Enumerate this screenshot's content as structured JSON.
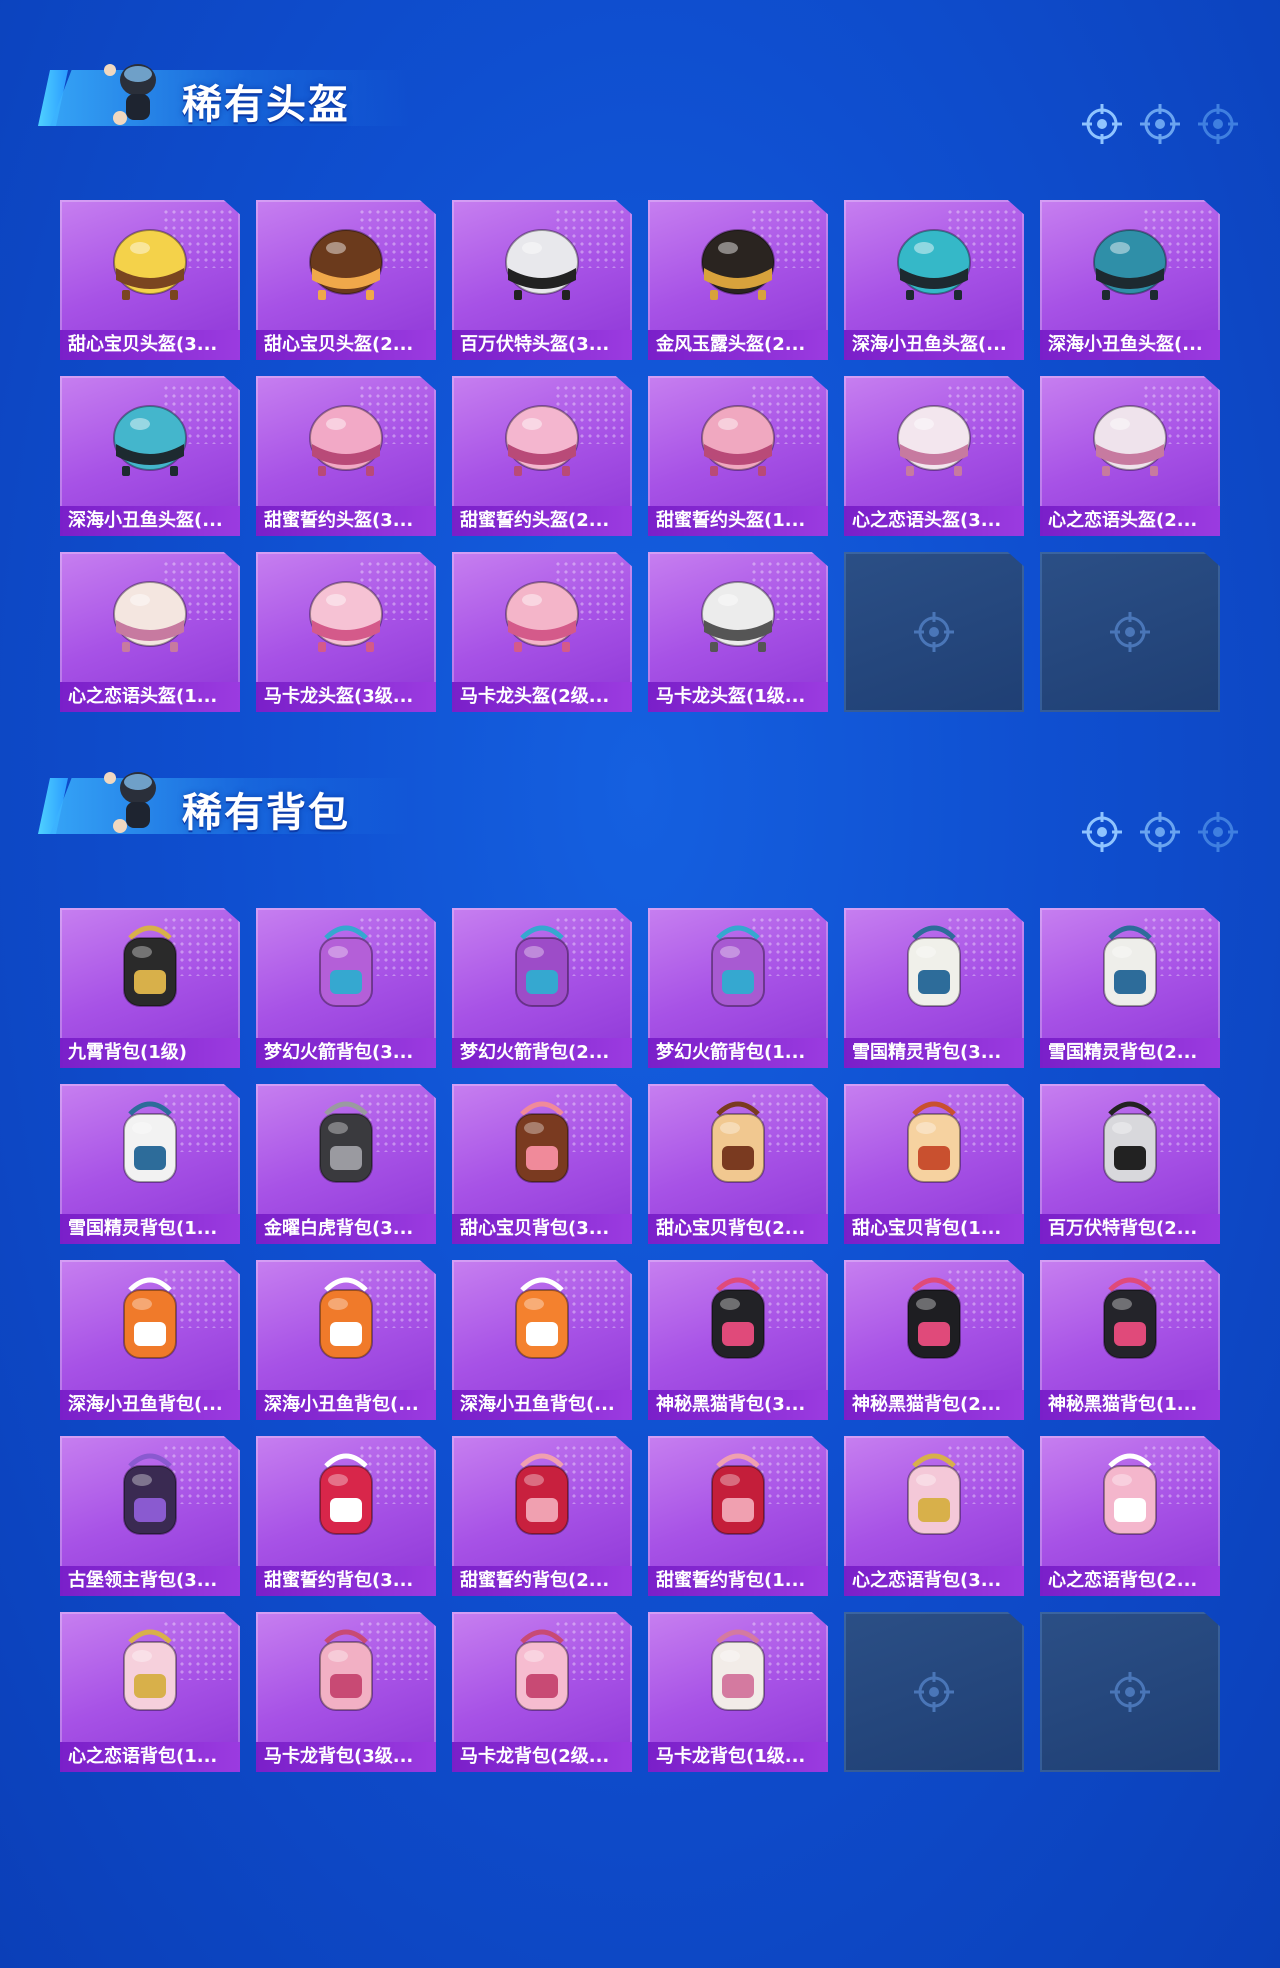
{
  "sections": [
    {
      "title": "稀有头盔",
      "items": [
        {
          "label": "甜心宝贝头盔(3...",
          "icon": "cupcake-helmet-icon",
          "color": "#f4d24a",
          "accent": "#7a4520"
        },
        {
          "label": "甜心宝贝头盔(2...",
          "icon": "chocolate-helmet-icon",
          "color": "#6b3a1c",
          "accent": "#f0a84a"
        },
        {
          "label": "百万伏特头盔(3...",
          "icon": "cat-ear-helmet-icon",
          "color": "#e8e8ec",
          "accent": "#222"
        },
        {
          "label": "金风玉露头盔(2...",
          "icon": "gold-horn-helmet-icon",
          "color": "#2a2420",
          "accent": "#d8a23c"
        },
        {
          "label": "深海小丑鱼头盔(...",
          "icon": "teal-visor-helmet-icon",
          "color": "#35b8c8",
          "accent": "#1d2a30"
        },
        {
          "label": "深海小丑鱼头盔(...",
          "icon": "teal-helmet-icon",
          "color": "#2f8fa8",
          "accent": "#1d2a30"
        },
        {
          "label": "深海小丑鱼头盔(...",
          "icon": "teal-open-helmet-icon",
          "color": "#44b6cc",
          "accent": "#1d2a30"
        },
        {
          "label": "甜蜜誓约头盔(3...",
          "icon": "pink-visor-helmet-icon",
          "color": "#f2a9c6",
          "accent": "#b94a78"
        },
        {
          "label": "甜蜜誓约头盔(2...",
          "icon": "pink-helmet-icon",
          "color": "#f4b6cf",
          "accent": "#b94a78"
        },
        {
          "label": "甜蜜誓约头盔(1...",
          "icon": "pink-round-helmet-icon",
          "color": "#f0a8c0",
          "accent": "#b94a78"
        },
        {
          "label": "心之恋语头盔(3...",
          "icon": "shell-visor-helmet-icon",
          "color": "#f3e6ee",
          "accent": "#c77aa0"
        },
        {
          "label": "心之恋语头盔(2...",
          "icon": "shell-helmet-icon",
          "color": "#efe3ec",
          "accent": "#c77aa0"
        },
        {
          "label": "心之恋语头盔(1...",
          "icon": "cream-open-helmet-icon",
          "color": "#f4e6e0",
          "accent": "#c77aa0"
        },
        {
          "label": "马卡龙头盔(3级...",
          "icon": "macaron-visor-helmet-icon",
          "color": "#f6c2d4",
          "accent": "#d45a8a"
        },
        {
          "label": "马卡龙头盔(2级...",
          "icon": "macaron-helmet-icon",
          "color": "#f4b5c9",
          "accent": "#d45a8a"
        },
        {
          "label": "马卡龙头盔(1级...",
          "icon": "white-open-helmet-icon",
          "color": "#ececec",
          "accent": "#555"
        }
      ]
    },
    {
      "title": "稀有背包",
      "items": [
        {
          "label": "九霄背包(1级)",
          "icon": "black-gold-backpack-icon",
          "color": "#2a2a2a",
          "accent": "#d8b04a"
        },
        {
          "label": "梦幻火箭背包(3...",
          "icon": "rocket-backpack-icon",
          "color": "#b45fd8",
          "accent": "#35a8d0"
        },
        {
          "label": "梦幻火箭背包(2...",
          "icon": "rocket-backpack-icon",
          "color": "#9d4cc8",
          "accent": "#35a8d0"
        },
        {
          "label": "梦幻火箭背包(1...",
          "icon": "rocket-backpack-icon",
          "color": "#a85ad2",
          "accent": "#35a8d0"
        },
        {
          "label": "雪国精灵背包(3...",
          "icon": "snowman-backpack-icon",
          "color": "#f0f0ea",
          "accent": "#2d6c9a"
        },
        {
          "label": "雪国精灵背包(2...",
          "icon": "snowman-backpack-icon",
          "color": "#eeeeea",
          "accent": "#2d6c9a"
        },
        {
          "label": "雪国精灵背包(1...",
          "icon": "bunny-backpack-icon",
          "color": "#f2f2f2",
          "accent": "#2d6c9a"
        },
        {
          "label": "金曜白虎背包(3...",
          "icon": "armor-backpack-icon",
          "color": "#3a3a3e",
          "accent": "#9a9aa0"
        },
        {
          "label": "甜心宝贝背包(3...",
          "icon": "dessert-backpack-icon",
          "color": "#7a3a20",
          "accent": "#f08a9a"
        },
        {
          "label": "甜心宝贝背包(2...",
          "icon": "cake-backpack-icon",
          "color": "#f1c890",
          "accent": "#7a3a20"
        },
        {
          "label": "甜心宝贝背包(1...",
          "icon": "cupcake-backpack-icon",
          "color": "#f6d2a0",
          "accent": "#c9502f"
        },
        {
          "label": "百万伏特背包(2...",
          "icon": "robot-cat-backpack-icon",
          "color": "#d8d8dc",
          "accent": "#222"
        },
        {
          "label": "深海小丑鱼背包(...",
          "icon": "clownfish-backpack-icon",
          "color": "#f07a2a",
          "accent": "#ffffff"
        },
        {
          "label": "深海小丑鱼背包(...",
          "icon": "clownfish-backpack-icon",
          "color": "#f07a2a",
          "accent": "#ffffff"
        },
        {
          "label": "深海小丑鱼背包(...",
          "icon": "clownfish-backpack-icon",
          "color": "#f4812e",
          "accent": "#ffffff"
        },
        {
          "label": "神秘黑猫背包(3...",
          "icon": "black-cat-backpack-icon",
          "color": "#222226",
          "accent": "#e04a7a"
        },
        {
          "label": "神秘黑猫背包(2...",
          "icon": "black-cat-backpack-icon",
          "color": "#1e1e22",
          "accent": "#e04a7a"
        },
        {
          "label": "神秘黑猫背包(1...",
          "icon": "black-cat-backpack-icon",
          "color": "#24242a",
          "accent": "#e04a7a"
        },
        {
          "label": "古堡领主背包(3...",
          "icon": "dark-knight-backpack-icon",
          "color": "#3a2a52",
          "accent": "#8a5ad0"
        },
        {
          "label": "甜蜜誓约背包(3...",
          "icon": "heart-wings-backpack-icon",
          "color": "#d8264a",
          "accent": "#ffffff"
        },
        {
          "label": "甜蜜誓约背包(2...",
          "icon": "heart-backpack-icon",
          "color": "#c8203e",
          "accent": "#f0a0b0"
        },
        {
          "label": "甜蜜誓约背包(1...",
          "icon": "heart-backpack-icon",
          "color": "#c41e3a",
          "accent": "#f0a0b0"
        },
        {
          "label": "心之恋语背包(3...",
          "icon": "star-backpack-icon",
          "color": "#f4c8d8",
          "accent": "#d8b04a"
        },
        {
          "label": "心之恋语背包(2...",
          "icon": "pink-bunny-backpack-icon",
          "color": "#f4b6cc",
          "accent": "#ffffff"
        },
        {
          "label": "心之恋语背包(1...",
          "icon": "star-backpack-icon",
          "color": "#f6d0dc",
          "accent": "#d8b04a"
        },
        {
          "label": "马卡龙背包(3级...",
          "icon": "macaron-backpack-icon",
          "color": "#f2b0c4",
          "accent": "#c84a74"
        },
        {
          "label": "马卡龙背包(2级...",
          "icon": "macaron-backpack-icon",
          "color": "#f6bcd0",
          "accent": "#c84a74"
        },
        {
          "label": "马卡龙背包(1级...",
          "icon": "white-bow-backpack-icon",
          "color": "#f2ece8",
          "accent": "#d47aa0"
        }
      ]
    }
  ]
}
